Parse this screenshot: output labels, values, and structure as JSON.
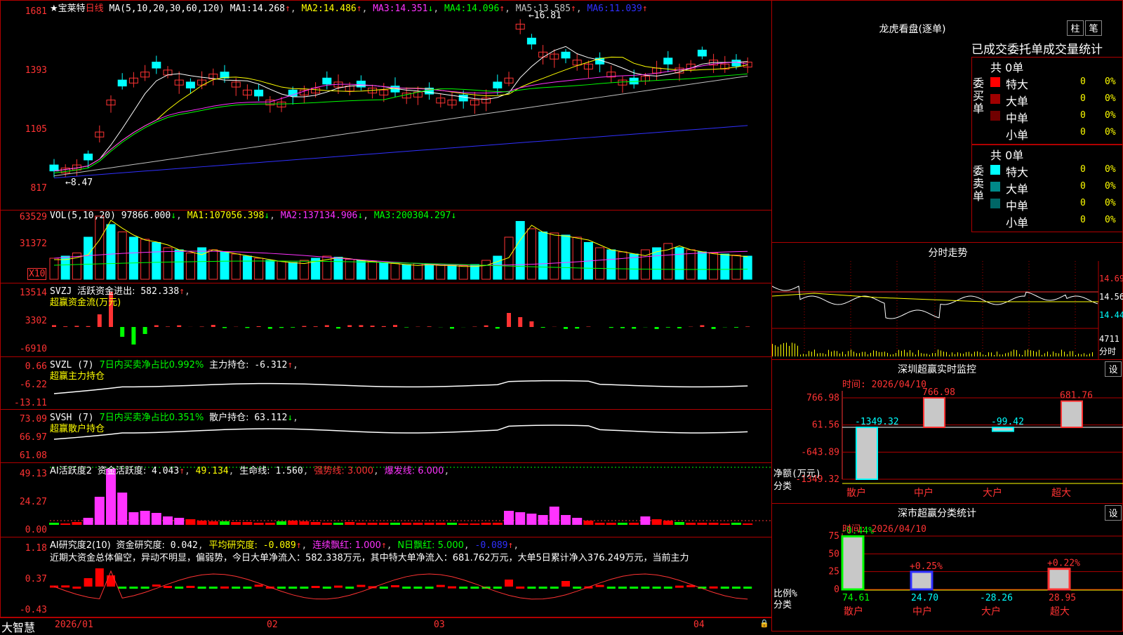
{
  "colors": {
    "up": "#ff3333",
    "down": "#00ffff",
    "grid": "#b00000",
    "ma1": "#ffffff",
    "ma2": "#ffff00",
    "ma3": "#ff33ff",
    "ma4": "#00ff00",
    "ma5": "#c0c0c0",
    "ma6": "#3030ff"
  },
  "price_panel": {
    "title": "★宝莱特",
    "period": "日线",
    "ma_header": "MA(5,10,20,30,60,120)",
    "ma": [
      {
        "label": "MA1:",
        "value": "14.268",
        "arrow": "↑"
      },
      {
        "label": "MA2:",
        "value": "14.486",
        "arrow": "↑"
      },
      {
        "label": "MA3:",
        "value": "14.351",
        "arrow": "↓"
      },
      {
        "label": "MA4:",
        "value": "14.096",
        "arrow": "↑"
      },
      {
        "label": "MA5:",
        "value": "13.585",
        "arrow": "↑"
      },
      {
        "label": "MA6:",
        "value": "11.039",
        "arrow": "↑"
      }
    ],
    "y_ticks": [
      "1681",
      "1393",
      "1105",
      "817"
    ],
    "high_mark": "16.81",
    "low_mark": "8.47"
  },
  "vol_panel": {
    "header": "VOL(5,10,20)",
    "value": "97866.000",
    "arrow": "↓",
    "ma": [
      {
        "label": "MA1:",
        "value": "107056.398",
        "arrow": "↓"
      },
      {
        "label": "MA2:",
        "value": "137134.906",
        "arrow": "↓"
      },
      {
        "label": "MA3:",
        "value": "200304.297",
        "arrow": "↓"
      }
    ],
    "y_ticks": [
      "63529",
      "31372"
    ],
    "unit": "X10"
  },
  "svzj_panel": {
    "header": "SVZJ",
    "line1_label": "活跃资金进出:",
    "line1_value": "582.338",
    "arrow": "↑",
    "sub": "超赢资金流(万元)",
    "y_ticks": [
      "13514",
      "3302",
      "-6910"
    ]
  },
  "svzl_panel": {
    "header": "SVZL (7)",
    "ratio_text": "7日内买卖净占比0.992%",
    "label": "主力持仓:",
    "value": "-6.312",
    "arrow": "↑",
    "sub": "超赢主力持仓",
    "y_ticks": [
      "0.66",
      "-6.22",
      "-13.11"
    ]
  },
  "svsh_panel": {
    "header": "SVSH (7)",
    "ratio_text": "7日内买卖净占比0.351%",
    "label": "散户持仓:",
    "value": "63.112",
    "arrow": "↓",
    "sub": "超赢散户持仓",
    "y_ticks": [
      "73.09",
      "66.97",
      "61.08"
    ]
  },
  "ai1_panel": {
    "header": "AI活跃度2",
    "label": "资金活跃度:",
    "value": "4.043",
    "arrow": "↑",
    "v2": "49.134",
    "life_label": "生命线:",
    "life": "1.560",
    "strong": "强势线: 3.000",
    "burst": "爆发线: 6.000",
    "y_ticks": [
      "49.13",
      "24.27",
      "0.00"
    ]
  },
  "ai2_panel": {
    "header": "AI研究度2(10)",
    "label": "资金研究度:",
    "value": "0.042",
    "avg_label": "平均研究度:",
    "avg": "-0.089",
    "lian": "连续飘红: 1.000",
    "nday": "N日飘红: 5.000",
    "last": "-0.089",
    "text": "近期大资金总体偏空，异动不明显，偏弱势，今日大单净流入：582.338万元，其中特大单净流入：681.762万元，大单5日累计净入376.249万元，当前主力",
    "y_ticks": [
      "1.18",
      "0.37",
      "-0.43"
    ]
  },
  "bottom_bar": {
    "app": "大智慧",
    "dates": [
      "2026/01",
      "02",
      "03",
      "04"
    ]
  },
  "longhu": {
    "title": "龙虎看盘(逐单)",
    "btn1": "柱",
    "btn2": "笔",
    "tabs": [
      "已成交",
      "委托单",
      "成交量统计"
    ],
    "buy_label": "委买单",
    "sell_label": "委卖单",
    "buy_total": "共 0单",
    "sell_total": "共 0单",
    "buy_rows": [
      {
        "name": "特大",
        "color": "#ff0000",
        "n": "0",
        "p": "0%"
      },
      {
        "name": "大单",
        "color": "#a00000",
        "n": "0",
        "p": "0%"
      },
      {
        "name": "中单",
        "color": "#700000",
        "n": "0",
        "p": "0%"
      },
      {
        "name": "小单",
        "color": "#000000",
        "n": "0",
        "p": "0%"
      }
    ],
    "sell_rows": [
      {
        "name": "特大",
        "color": "#00ffff",
        "n": "0",
        "p": "0%"
      },
      {
        "name": "大单",
        "color": "#008888",
        "n": "0",
        "p": "0%"
      },
      {
        "name": "中单",
        "color": "#006666",
        "n": "0",
        "p": "0%"
      },
      {
        "name": "小单",
        "color": "#000000",
        "n": "0",
        "p": "0%"
      }
    ]
  },
  "intraday": {
    "title": "分时走势",
    "y_ticks": [
      "14.69",
      "14.56",
      "14.44"
    ],
    "vol_tick": "4711",
    "vol_unit": "分时"
  },
  "monitor": {
    "title": "深圳超赢实时监控",
    "btn": "设",
    "time": "时间: 2026/04/10",
    "y_ticks": [
      "766.98",
      "61.56",
      "-643.89",
      "-1349.32"
    ],
    "y_label": "净额(万元)",
    "x_label": "分类",
    "categories": [
      "散户",
      "中户",
      "大户",
      "超大"
    ],
    "values": [
      -1349.32,
      766.98,
      -99.42,
      681.76
    ],
    "value_labels": [
      "-1349.32",
      "766.98",
      "-99.42",
      "681.76"
    ]
  },
  "classify": {
    "title": "深市超赢分类统计",
    "btn": "设",
    "time": "时间: 2026/04/10",
    "y_ticks": [
      "75",
      "50",
      "25",
      "0"
    ],
    "y_label": "比例%",
    "x_label": "分类",
    "categories": [
      "散户",
      "中户",
      "大户",
      "超大"
    ],
    "values": [
      74.61,
      24.7,
      -28.26,
      28.95
    ],
    "bottom_labels": [
      "74.61",
      "24.70",
      "-28.26",
      "28.95"
    ],
    "changes": [
      "-0.44%",
      "+0.25%",
      "",
      "+0.22%"
    ]
  }
}
